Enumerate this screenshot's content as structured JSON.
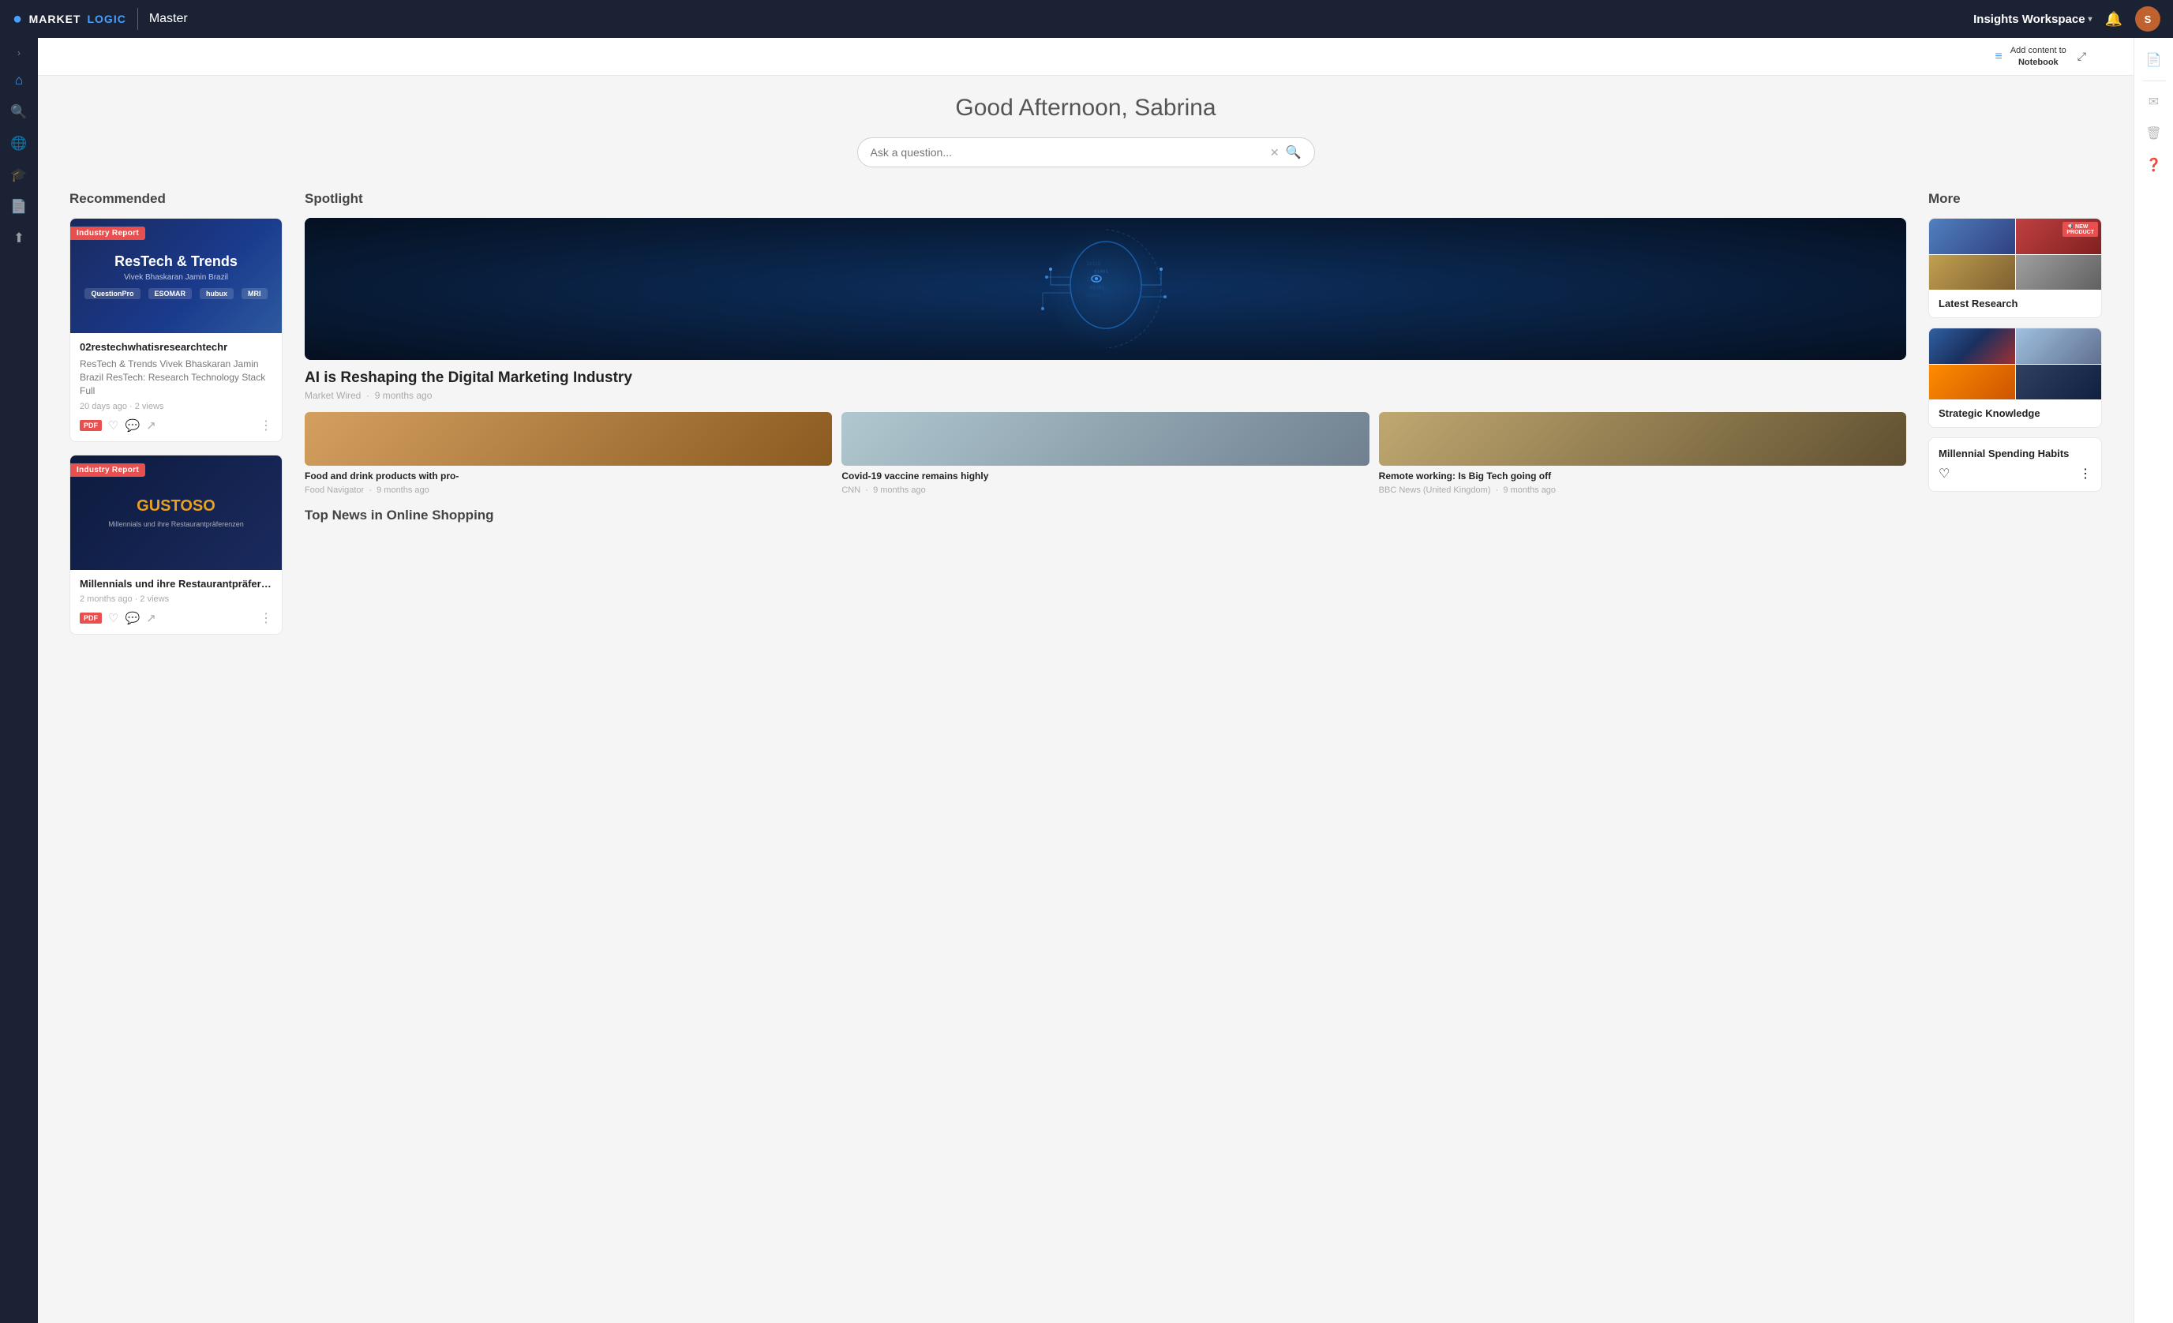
{
  "app": {
    "logo_market": "MARKET",
    "logo_logic": "LOGIC",
    "logo_icon": "●",
    "instance_name": "Master",
    "workspace_label": "Insights Workspace",
    "workspace_caret": "▾"
  },
  "topnav": {
    "notification_icon": "🔔",
    "avatar_initials": "S"
  },
  "sidebar": {
    "chevron": "›",
    "items": [
      {
        "icon": "⌂",
        "name": "home",
        "label": "Home",
        "active": true
      },
      {
        "icon": "🔍",
        "name": "search",
        "label": "Search"
      },
      {
        "icon": "🌐",
        "name": "globe",
        "label": "Globe"
      },
      {
        "icon": "🎓",
        "name": "learn",
        "label": "Learn"
      },
      {
        "icon": "📄",
        "name": "docs",
        "label": "Docs"
      },
      {
        "icon": "⬆",
        "name": "upload",
        "label": "Upload"
      }
    ]
  },
  "notebook": {
    "filter_icon": "≡",
    "add_label": "Add content to",
    "notebook_label": "Notebook",
    "expand_icon": "⤢"
  },
  "greeting": "Good Afternoon, Sabrina",
  "search": {
    "placeholder": "Ask a question...",
    "clear_icon": "✕",
    "search_icon": "🔍"
  },
  "recommended": {
    "section_title": "Recommended",
    "cards": [
      {
        "badge": "Industry Report",
        "title_display": "ResTech & Trends",
        "authors": "Vivek Bhaskaran   Jamin Brazil",
        "logos": [
          "QuestionPro",
          "ESOMAR",
          "hubux",
          "MRI"
        ],
        "card_title": "02restechwhatisresearchtechr",
        "description": "ResTech & Trends Vivek Bhaskaran Jamin Brazil ResTech: Research Technology Stack Full",
        "meta": "20 days ago · 2 views",
        "has_pdf": true
      },
      {
        "badge": "Industry Report",
        "title_display": "GUSTOSO",
        "sub_title": "Millennials und ihre Restaurantpräferenzen",
        "card_title": "Millennials und ihre Restaurantpräferenzen",
        "description": "",
        "meta": "2 months ago · 2 views",
        "has_pdf": true
      }
    ]
  },
  "spotlight": {
    "section_title": "Spotlight",
    "main_article": {
      "title": "AI is Reshaping the Digital Marketing Industry",
      "source": "Market Wired",
      "age": "9 months ago"
    },
    "sub_articles": [
      {
        "title": "Food and drink products with pro-",
        "source": "Food Navigator",
        "age": "9 months ago",
        "img_type": "food"
      },
      {
        "title": "Covid-19 vaccine remains highly",
        "source": "CNN",
        "age": "9 months ago",
        "img_type": "covid"
      },
      {
        "title": "Remote working: Is Big Tech going off",
        "source": "BBC News (United Kingdom)",
        "age": "9 months ago",
        "img_type": "remote"
      }
    ],
    "bottom_section_title": "Top News in Online Shopping"
  },
  "more": {
    "section_title": "More",
    "cards": [
      {
        "id": "latest-research",
        "title": "Latest Research",
        "img_types": [
          "people-blue",
          "new-product-red",
          "drink-brown",
          "search-gray"
        ],
        "has_new_product": true
      },
      {
        "id": "strategic-knowledge",
        "title": "Strategic Knowledge",
        "img_types": [
          "sk1",
          "sk2",
          "sk3",
          "sk4"
        ]
      }
    ],
    "millennial_card": {
      "title": "Millennial Spending Habits"
    }
  },
  "right_sidebar": {
    "icons": [
      "📄",
      "✉",
      "🗑",
      "❓"
    ]
  }
}
